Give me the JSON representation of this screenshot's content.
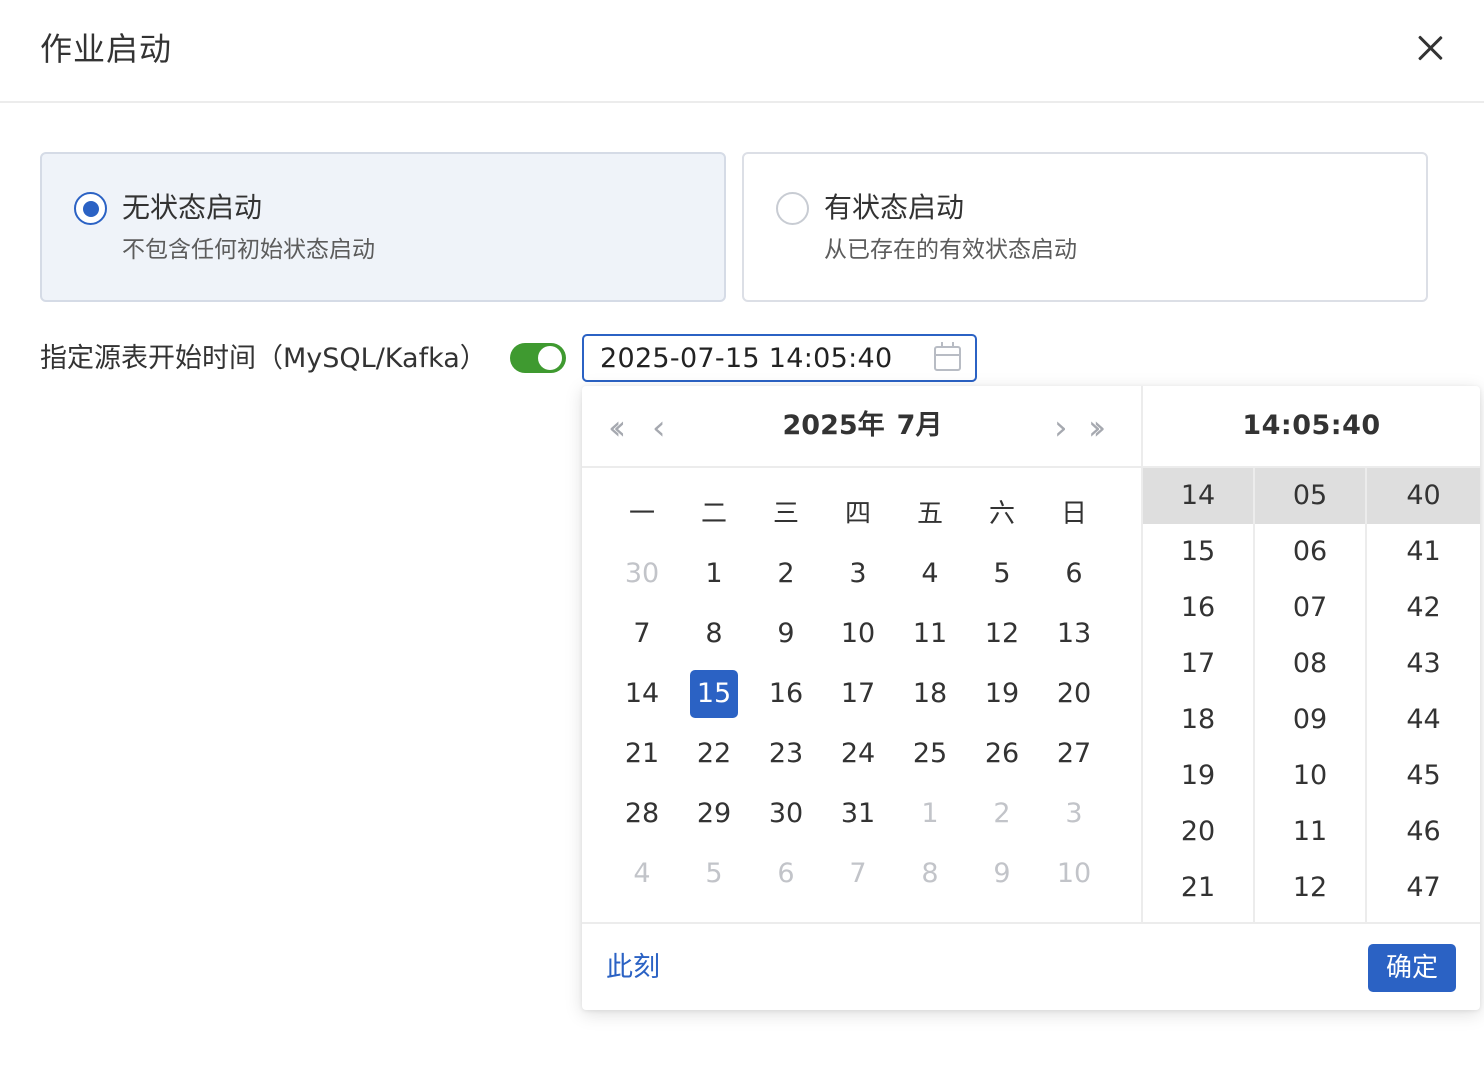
{
  "dialog": {
    "title": "作业启动",
    "close_icon": "close-icon"
  },
  "modes": [
    {
      "title": "无状态启动",
      "desc": "不包含任何初始状态启动",
      "selected": true
    },
    {
      "title": "有状态启动",
      "desc": "从已存在的有效状态启动",
      "selected": false
    }
  ],
  "start_time": {
    "label": "指定源表开始时间（MySQL/Kafka）",
    "enabled": true,
    "value": "2025-07-15 14:05:40",
    "icon": "calendar-icon"
  },
  "picker": {
    "nav": {
      "prev_year": "«",
      "prev_month": "‹",
      "next_month": "›",
      "next_year": "»"
    },
    "year_label": "2025年",
    "month_label": "7月",
    "weekdays": [
      "一",
      "二",
      "三",
      "四",
      "五",
      "六",
      "日"
    ],
    "weeks": [
      [
        {
          "d": "30",
          "out": true
        },
        {
          "d": "1"
        },
        {
          "d": "2"
        },
        {
          "d": "3"
        },
        {
          "d": "4"
        },
        {
          "d": "5"
        },
        {
          "d": "6"
        }
      ],
      [
        {
          "d": "7"
        },
        {
          "d": "8"
        },
        {
          "d": "9"
        },
        {
          "d": "10"
        },
        {
          "d": "11"
        },
        {
          "d": "12"
        },
        {
          "d": "13"
        }
      ],
      [
        {
          "d": "14"
        },
        {
          "d": "15",
          "selected": true
        },
        {
          "d": "16"
        },
        {
          "d": "17"
        },
        {
          "d": "18"
        },
        {
          "d": "19"
        },
        {
          "d": "20"
        }
      ],
      [
        {
          "d": "21"
        },
        {
          "d": "22"
        },
        {
          "d": "23"
        },
        {
          "d": "24"
        },
        {
          "d": "25"
        },
        {
          "d": "26"
        },
        {
          "d": "27"
        }
      ],
      [
        {
          "d": "28"
        },
        {
          "d": "29"
        },
        {
          "d": "30"
        },
        {
          "d": "31"
        },
        {
          "d": "1",
          "out": true
        },
        {
          "d": "2",
          "out": true
        },
        {
          "d": "3",
          "out": true
        }
      ],
      [
        {
          "d": "4",
          "out": true
        },
        {
          "d": "5",
          "out": true
        },
        {
          "d": "6",
          "out": true
        },
        {
          "d": "7",
          "out": true
        },
        {
          "d": "8",
          "out": true
        },
        {
          "d": "9",
          "out": true
        },
        {
          "d": "10",
          "out": true
        }
      ]
    ],
    "time_title": "14:05:40",
    "hours": [
      "14",
      "15",
      "16",
      "17",
      "18",
      "19",
      "20",
      "21"
    ],
    "minutes": [
      "05",
      "06",
      "07",
      "08",
      "09",
      "10",
      "11",
      "12"
    ],
    "seconds": [
      "40",
      "41",
      "42",
      "43",
      "44",
      "45",
      "46",
      "47"
    ],
    "selected_hour": "14",
    "selected_minute": "05",
    "selected_second": "40",
    "now_label": "此刻",
    "ok_label": "确定"
  },
  "colors": {
    "accent": "#2b62c4",
    "switch_on": "#3f9a30",
    "selected_card_bg": "#eff3f9",
    "selected_time_bg": "#dedede"
  }
}
